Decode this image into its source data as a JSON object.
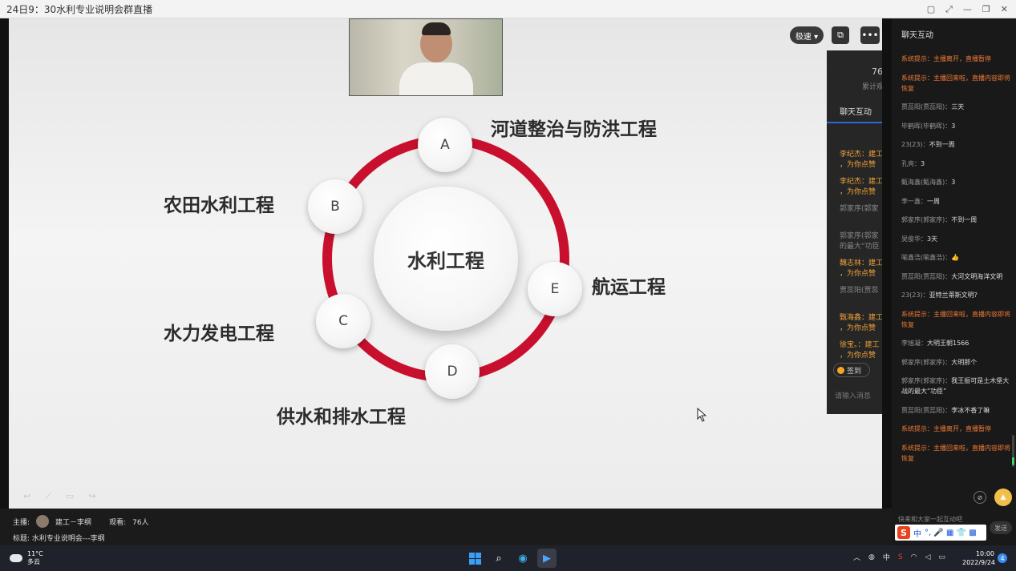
{
  "window": {
    "title": "24日9：30水利专业说明会群直播",
    "buttons": [
      "▢",
      "⤢",
      "—",
      "❐",
      "✕"
    ]
  },
  "slide": {
    "center": "水利工程",
    "nodes": {
      "a": "A",
      "b": "B",
      "c": "C",
      "d": "D",
      "e": "E"
    },
    "labels": {
      "a": "河道整治与防洪工程",
      "b": "农田水利工程",
      "c": "水力发电工程",
      "d": "供水和排水工程",
      "e": "航运工程"
    },
    "accent_color": "#c8102e"
  },
  "player": {
    "speed": "极速 ▾",
    "more": "•••",
    "share": "⧉",
    "tools": [
      "↩",
      "⟋",
      "▭",
      "↪"
    ]
  },
  "overlay": {
    "count": "76",
    "count_label": "累计观",
    "tab": "聊天互动",
    "messages": [
      {
        "line1": "李纪杰：建工",
        "line2": "，为你点赞",
        "gift": true
      },
      {
        "line1": "李纪杰：建工",
        "line2": "，为你点赞",
        "gift": true
      },
      {
        "line1": "郭家序(郭家",
        "line2": "",
        "gift": false
      },
      {
        "line1": "郭家序(郭家",
        "line2": "的最大“功臣",
        "gift": false
      },
      {
        "line1": "魏志林：建工",
        "line2": "，为你点赞",
        "gift": true
      },
      {
        "line1": "贾蕊阳(贾蕊",
        "line2": "",
        "gift": false
      },
      {
        "line1": "甄海鑫：建工",
        "line2": "，为你点赞",
        "gift": true
      },
      {
        "line1": "徐宝。：建工",
        "line2": "，为你点赞",
        "gift": true
      }
    ],
    "sign": "签到",
    "input": "请输入消息"
  },
  "info": {
    "host_label": "主播:",
    "host": "建工－李纲",
    "viewers_label": "观看:",
    "viewers": "76人",
    "title_label": "标题:",
    "title": "水利专业说明会---李纲"
  },
  "chat": {
    "header": "聊天互动",
    "messages": [
      {
        "name": "",
        "text": "系统提示：主播离开，直播暂停",
        "type": "sys"
      },
      {
        "name": "",
        "text": "系统提示：主播回来啦，直播内容即将恢复",
        "type": "sys"
      },
      {
        "name": "贾蕊阳(贾蕊阳)：",
        "text": "三天",
        "type": "user"
      },
      {
        "name": "毕鹤晖(毕鹤晖)：",
        "text": "3",
        "type": "user"
      },
      {
        "name": "23(23)：",
        "text": "不到一周",
        "type": "user"
      },
      {
        "name": "孔亮：",
        "text": "3",
        "type": "user"
      },
      {
        "name": "甄海鑫(甄海鑫)：",
        "text": "3",
        "type": "user"
      },
      {
        "name": "李一鑫：",
        "text": "一周",
        "type": "user"
      },
      {
        "name": "郭家序(郭家序)：",
        "text": "不到一周",
        "type": "user"
      },
      {
        "name": "吴俊华：",
        "text": "3天",
        "type": "user"
      },
      {
        "name": "喻鑫浩(喻鑫浩)：",
        "text": "👍",
        "type": "user"
      },
      {
        "name": "贾蕊阳(贾蕊阳)：",
        "text": "大河文明海洋文明",
        "type": "user"
      },
      {
        "name": "23(23)：",
        "text": "亚特兰蒂斯文明?",
        "type": "user"
      },
      {
        "name": "",
        "text": "系统提示：主播回来啦，直播内容即将恢复",
        "type": "sys"
      },
      {
        "name": "李旭凝：",
        "text": "大明王朝1566",
        "type": "user"
      },
      {
        "name": "郭家序(郭家序)：",
        "text": "大明那个",
        "type": "user"
      },
      {
        "name": "郭家序(郭家序)：",
        "text": "我王振可是土木堡大战的最大“功臣”",
        "type": "user"
      },
      {
        "name": "贾蕊阳(贾蕊阳)：",
        "text": "李冰不香了嘛",
        "type": "user"
      },
      {
        "name": "",
        "text": "系统提示：主播离开，直播暂停",
        "type": "sys"
      },
      {
        "name": "",
        "text": "系统提示：主播回来啦，直播内容即将恢复",
        "type": "sys"
      }
    ],
    "placeholder": "快来和大家一起互动吧",
    "send": "发送",
    "ime": {
      "logo": "S",
      "lang": "中",
      "icons": "°, 🎤 ▦ 👕 ▩"
    }
  },
  "taskbar": {
    "temp": "11°C",
    "weather": "多云",
    "lang": "中",
    "time": "10:00",
    "date": "2022/9/24",
    "notifications": "4"
  }
}
